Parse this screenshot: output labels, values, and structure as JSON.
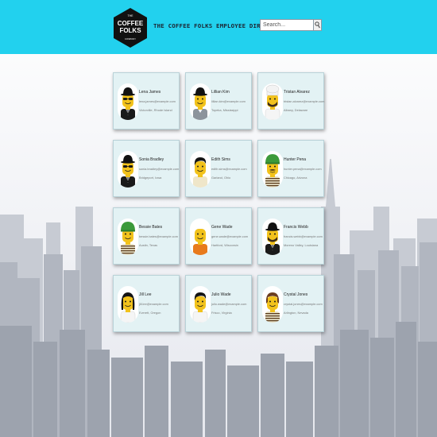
{
  "header": {
    "logo_top": "THE",
    "logo_line1": "COFFEE",
    "logo_line2": "FOLKS",
    "logo_bottom": "COMPANY",
    "title": "THE COFFEE FOLKS EMPLOYEE DIRECTORY"
  },
  "search": {
    "placeholder": "Search...",
    "icon": "magnifier-icon"
  },
  "employees": [
    {
      "name": "Lena James",
      "email": "lena.james@example.com",
      "location": "Victorville, Rhode Island",
      "avatar": {
        "hat": "bowler",
        "face": "glasses",
        "shirt": "suit"
      }
    },
    {
      "name": "Lillian Kim",
      "email": "lillian.kim@example.com",
      "location": "Topeka, Mississippi",
      "avatar": {
        "hat": "bowler",
        "face": "smile",
        "shirt": "gray"
      }
    },
    {
      "name": "Tristan Alvarez",
      "email": "tristan.alvarez@example.com",
      "location": "Albany, Delaware",
      "avatar": {
        "hat": "chef",
        "face": "beard",
        "shirt": "white"
      }
    },
    {
      "name": "Sonia Bradley",
      "email": "sonia.bradley@example.com",
      "location": "Bridgeport, Iowa",
      "avatar": {
        "hat": "bowler",
        "face": "glasses",
        "shirt": "suit"
      }
    },
    {
      "name": "Edith Sims",
      "email": "edith.sims@example.com",
      "location": "Garland, Ohio",
      "avatar": {
        "hat": "hair",
        "face": "smile",
        "shirt": "cream"
      }
    },
    {
      "name": "Hunter Pena",
      "email": "hunter.pena@example.com",
      "location": "Chicago, Arizona",
      "avatar": {
        "hat": "green-helmet",
        "face": "mustache",
        "shirt": "striped"
      }
    },
    {
      "name": "Bessie Bates",
      "email": "bessie.bates@example.com",
      "location": "Austin, Texas",
      "avatar": {
        "hat": "green-helmet",
        "face": "smile",
        "shirt": "striped"
      }
    },
    {
      "name": "Gene Wade",
      "email": "gene.wade@example.com",
      "location": "Hartford, Wisconsin",
      "avatar": {
        "hat": "none",
        "face": "smile",
        "shirt": "orange"
      }
    },
    {
      "name": "Francis Webb",
      "email": "francis.webb@example.com",
      "location": "Moreno Valley, Louisiana",
      "avatar": {
        "hat": "bowler",
        "face": "beard",
        "shirt": "suit"
      }
    },
    {
      "name": "Jill Lee",
      "email": "jill.lee@example.com",
      "location": "Everett, Oregon",
      "avatar": {
        "hat": "long-hair",
        "face": "smile",
        "shirt": "white"
      }
    },
    {
      "name": "Julio Wade",
      "email": "julio.wade@example.com",
      "location": "Frisco, Virginia",
      "avatar": {
        "hat": "hair",
        "face": "smile",
        "shirt": "white"
      }
    },
    {
      "name": "Crystal Jones",
      "email": "crystal.jones@example.com",
      "location": "Arlington, Nevada",
      "avatar": {
        "hat": "brown-hair",
        "face": "smile",
        "shirt": "striped"
      }
    }
  ],
  "colors": {
    "header_bg": "#22d1ee",
    "title_text": "#1c2431",
    "card_bg": "#e3f2f4",
    "card_border": "#b9d2d8",
    "skin": "#f2c21b",
    "skyline": "#9da3ae"
  }
}
